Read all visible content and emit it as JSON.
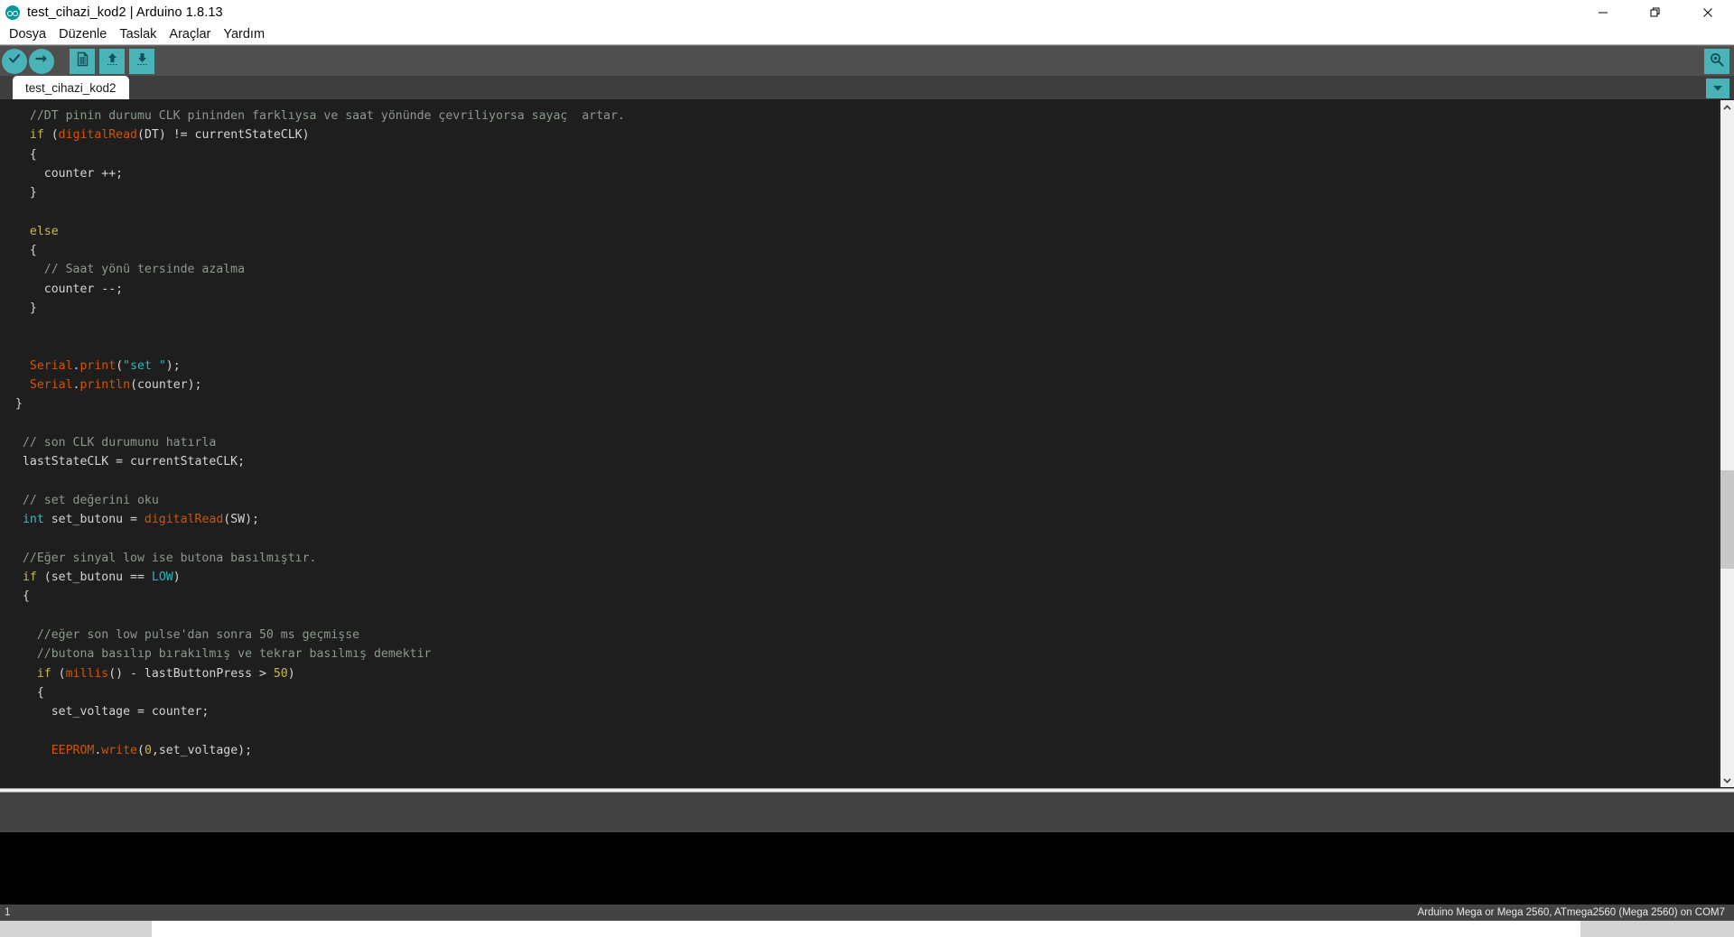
{
  "window": {
    "title": "test_cihazi_kod2 | Arduino 1.8.13",
    "logo_icon": "arduino-logo-icon",
    "controls": [
      {
        "name": "minimize-button",
        "icon": "minimize-icon"
      },
      {
        "name": "restore-button",
        "icon": "restore-icon"
      },
      {
        "name": "close-button",
        "icon": "close-icon"
      }
    ]
  },
  "menu": {
    "items": [
      {
        "label": "Dosya"
      },
      {
        "label": "Düzenle"
      },
      {
        "label": "Taslak"
      },
      {
        "label": "Araçlar"
      },
      {
        "label": "Yardım"
      }
    ]
  },
  "toolbar": {
    "accent_color": "#4ab3b7",
    "background_color": "#4f4f4f",
    "buttons": [
      {
        "name": "verify-button",
        "icon": "checkmark-icon",
        "tooltip": "Doğrula"
      },
      {
        "name": "upload-button",
        "icon": "arrow-right-icon",
        "tooltip": "Yükle"
      },
      {
        "name": "new-button",
        "icon": "new-file-icon",
        "tooltip": "Yeni"
      },
      {
        "name": "open-button",
        "icon": "arrow-up-icon",
        "tooltip": "Aç"
      },
      {
        "name": "save-button",
        "icon": "arrow-down-icon",
        "tooltip": "Kaydet"
      }
    ],
    "serial_monitor": {
      "name": "serial-monitor-button",
      "icon": "magnifier-icon",
      "tooltip": "Seri Port Ekranı"
    }
  },
  "tabs": {
    "active": "test_cihazi_kod2",
    "items": [
      {
        "label": "test_cihazi_kod2"
      }
    ],
    "menu_button": {
      "name": "tab-menu-button",
      "icon": "chevron-down-icon"
    }
  },
  "editor": {
    "background_color": "#1e1e1e",
    "scrollbar": {
      "up_icon": "chevron-up-icon",
      "down_icon": "chevron-down-icon",
      "thumb_top_percent": 54,
      "thumb_height_percent": 15
    },
    "lines": [
      {
        "indent": 0,
        "tokens": [
          {
            "t": "comment",
            "s": "  //DT pinin durumu CLK pininden farklıysa ve saat yönünde çevriliyorsa sayaç  artar."
          }
        ]
      },
      {
        "indent": 0,
        "tokens": [
          {
            "t": "keyword",
            "s": "  if"
          },
          {
            "t": "plain",
            "s": " ("
          },
          {
            "t": "func",
            "s": "digitalRead"
          },
          {
            "t": "plain",
            "s": "(DT) != currentStateCLK)"
          }
        ]
      },
      {
        "indent": 0,
        "tokens": [
          {
            "t": "plain",
            "s": "  {"
          }
        ]
      },
      {
        "indent": 0,
        "tokens": [
          {
            "t": "plain",
            "s": "    counter ++;"
          }
        ]
      },
      {
        "indent": 0,
        "tokens": [
          {
            "t": "plain",
            "s": "  }"
          }
        ]
      },
      {
        "indent": 0,
        "tokens": [
          {
            "t": "plain",
            "s": ""
          }
        ]
      },
      {
        "indent": 0,
        "tokens": [
          {
            "t": "keyword",
            "s": "  else"
          }
        ]
      },
      {
        "indent": 0,
        "tokens": [
          {
            "t": "plain",
            "s": "  {"
          }
        ]
      },
      {
        "indent": 0,
        "tokens": [
          {
            "t": "comment",
            "s": "    // Saat yönü tersinde azalma"
          }
        ]
      },
      {
        "indent": 0,
        "tokens": [
          {
            "t": "plain",
            "s": "    counter --;"
          }
        ]
      },
      {
        "indent": 0,
        "tokens": [
          {
            "t": "plain",
            "s": "  }"
          }
        ]
      },
      {
        "indent": 0,
        "tokens": [
          {
            "t": "plain",
            "s": ""
          }
        ]
      },
      {
        "indent": 0,
        "tokens": [
          {
            "t": "plain",
            "s": ""
          }
        ]
      },
      {
        "indent": 0,
        "tokens": [
          {
            "t": "lib",
            "s": "  Serial"
          },
          {
            "t": "plain",
            "s": "."
          },
          {
            "t": "method",
            "s": "print"
          },
          {
            "t": "plain",
            "s": "("
          },
          {
            "t": "string",
            "s": "\"set \""
          },
          {
            "t": "plain",
            "s": ");"
          }
        ]
      },
      {
        "indent": 0,
        "tokens": [
          {
            "t": "lib",
            "s": "  Serial"
          },
          {
            "t": "plain",
            "s": "."
          },
          {
            "t": "method",
            "s": "println"
          },
          {
            "t": "plain",
            "s": "(counter);"
          }
        ]
      },
      {
        "indent": 0,
        "tokens": [
          {
            "t": "plain",
            "s": "}"
          }
        ]
      },
      {
        "indent": 0,
        "tokens": [
          {
            "t": "plain",
            "s": ""
          }
        ]
      },
      {
        "indent": 0,
        "tokens": [
          {
            "t": "comment",
            "s": " // son CLK durumunu hatırla"
          }
        ]
      },
      {
        "indent": 0,
        "tokens": [
          {
            "t": "plain",
            "s": " lastStateCLK = currentStateCLK;"
          }
        ]
      },
      {
        "indent": 0,
        "tokens": [
          {
            "t": "plain",
            "s": ""
          }
        ]
      },
      {
        "indent": 0,
        "tokens": [
          {
            "t": "comment",
            "s": " // set değerini oku"
          }
        ]
      },
      {
        "indent": 0,
        "tokens": [
          {
            "t": "type",
            "s": " int"
          },
          {
            "t": "plain",
            "s": " set_butonu = "
          },
          {
            "t": "func",
            "s": "digitalRead"
          },
          {
            "t": "plain",
            "s": "(SW);"
          }
        ]
      },
      {
        "indent": 0,
        "tokens": [
          {
            "t": "plain",
            "s": ""
          }
        ]
      },
      {
        "indent": 0,
        "tokens": [
          {
            "t": "comment",
            "s": " //Eğer sinyal low ise butona basılmıştır."
          }
        ]
      },
      {
        "indent": 0,
        "tokens": [
          {
            "t": "keyword",
            "s": " if"
          },
          {
            "t": "plain",
            "s": " (set_butonu == "
          },
          {
            "t": "const",
            "s": "LOW"
          },
          {
            "t": "plain",
            "s": ")"
          }
        ]
      },
      {
        "indent": 0,
        "tokens": [
          {
            "t": "plain",
            "s": " {"
          }
        ]
      },
      {
        "indent": 0,
        "tokens": [
          {
            "t": "plain",
            "s": ""
          }
        ]
      },
      {
        "indent": 0,
        "tokens": [
          {
            "t": "comment",
            "s": "   //eğer son low pulse'dan sonra 50 ms geçmişse"
          }
        ]
      },
      {
        "indent": 0,
        "tokens": [
          {
            "t": "comment",
            "s": "   //butona basılıp bırakılmış ve tekrar basılmış demektir"
          }
        ]
      },
      {
        "indent": 0,
        "tokens": [
          {
            "t": "keyword",
            "s": "   if"
          },
          {
            "t": "plain",
            "s": " ("
          },
          {
            "t": "func",
            "s": "millis"
          },
          {
            "t": "plain",
            "s": "() - lastButtonPress > "
          },
          {
            "t": "number",
            "s": "50"
          },
          {
            "t": "plain",
            "s": ")"
          }
        ]
      },
      {
        "indent": 0,
        "tokens": [
          {
            "t": "plain",
            "s": "   {"
          }
        ]
      },
      {
        "indent": 0,
        "tokens": [
          {
            "t": "plain",
            "s": "     set_voltage = counter;"
          }
        ]
      },
      {
        "indent": 0,
        "tokens": [
          {
            "t": "plain",
            "s": ""
          }
        ]
      },
      {
        "indent": 0,
        "tokens": [
          {
            "t": "lib",
            "s": "     EEPROM"
          },
          {
            "t": "plain",
            "s": "."
          },
          {
            "t": "method",
            "s": "write"
          },
          {
            "t": "plain",
            "s": "("
          },
          {
            "t": "number",
            "s": "0"
          },
          {
            "t": "plain",
            "s": ",set_voltage);"
          }
        ]
      }
    ]
  },
  "console": {
    "output": ""
  },
  "status": {
    "line_number": "1",
    "board": "Arduino Mega or Mega 2560, ATmega2560 (Mega 2560) on COM7"
  }
}
